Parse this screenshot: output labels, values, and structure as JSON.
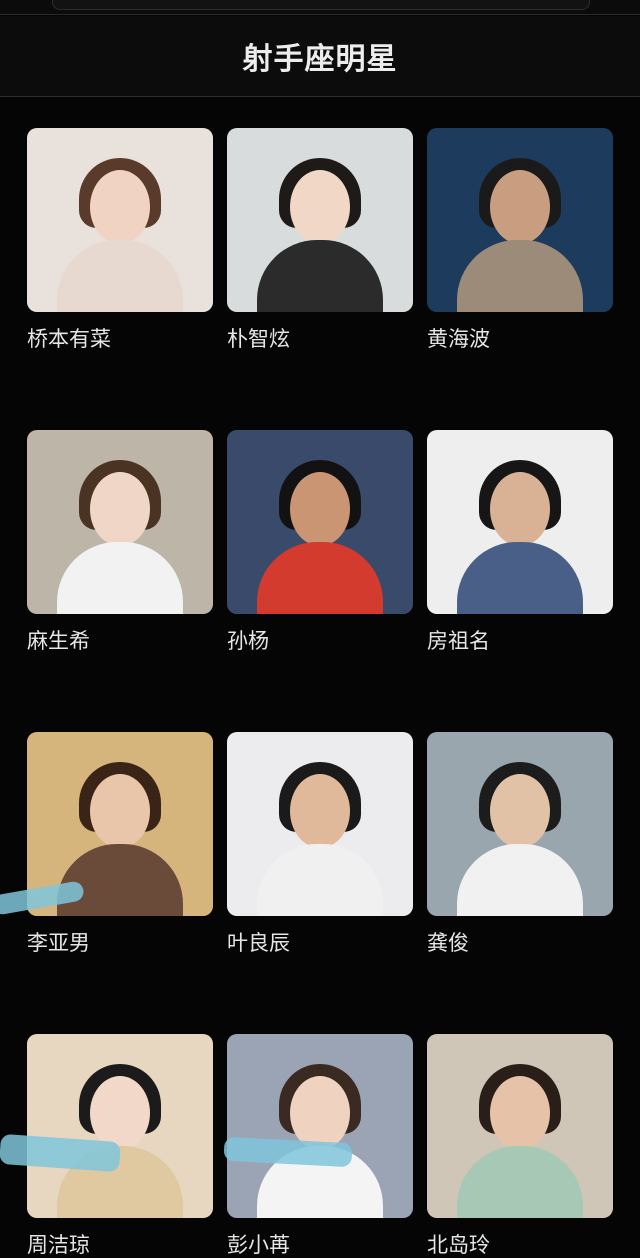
{
  "header": {
    "title": "射手座明星"
  },
  "stars": [
    {
      "name": "桥本有菜",
      "bg": "#e9e2dc",
      "hair": "#5a3a2a",
      "top": "#e7d9cf",
      "skin": "#f0d3c2"
    },
    {
      "name": "朴智炫",
      "bg": "#d9dcdc",
      "hair": "#1e1a18",
      "top": "#2b2b2b",
      "skin": "#f1d7c6"
    },
    {
      "name": "黄海波",
      "bg": "#1d3b5c",
      "hair": "#1a1a1a",
      "top": "#9b8b78",
      "skin": "#c99d7f"
    },
    {
      "name": "麻生希",
      "bg": "#bcb5a8",
      "hair": "#4a3322",
      "top": "#f2f2f2",
      "skin": "#efd6c6"
    },
    {
      "name": "孙杨",
      "bg": "#3a4a6a",
      "hair": "#121212",
      "top": "#d23b2e",
      "skin": "#c99573"
    },
    {
      "name": "房祖名",
      "bg": "#eeeeee",
      "hair": "#161616",
      "top": "#4a5f88",
      "skin": "#d9b295"
    },
    {
      "name": "李亚男",
      "bg": "#d6b57c",
      "hair": "#3a2418",
      "top": "#6a4b3a",
      "skin": "#e9c6a9"
    },
    {
      "name": "叶良辰",
      "bg": "#ececef",
      "hair": "#1a1a1a",
      "top": "#f0f0f0",
      "skin": "#e0b99b"
    },
    {
      "name": "龚俊",
      "bg": "#9aa6ad",
      "hair": "#1c1c1c",
      "top": "#f1f1f1",
      "skin": "#e2c2a7"
    },
    {
      "name": "周洁琼",
      "bg": "#e8d7c0",
      "hair": "#1b1b1b",
      "top": "#e0c9a0",
      "skin": "#f2d8c8"
    },
    {
      "name": "彭小苒",
      "bg": "#9aa4b4",
      "hair": "#3a2a22",
      "top": "#f4f4f4",
      "skin": "#efd2bf"
    },
    {
      "name": "北岛玲",
      "bg": "#cfc6b8",
      "hair": "#2a1e18",
      "top": "#a8c8b6",
      "skin": "#e6c2a8"
    }
  ]
}
